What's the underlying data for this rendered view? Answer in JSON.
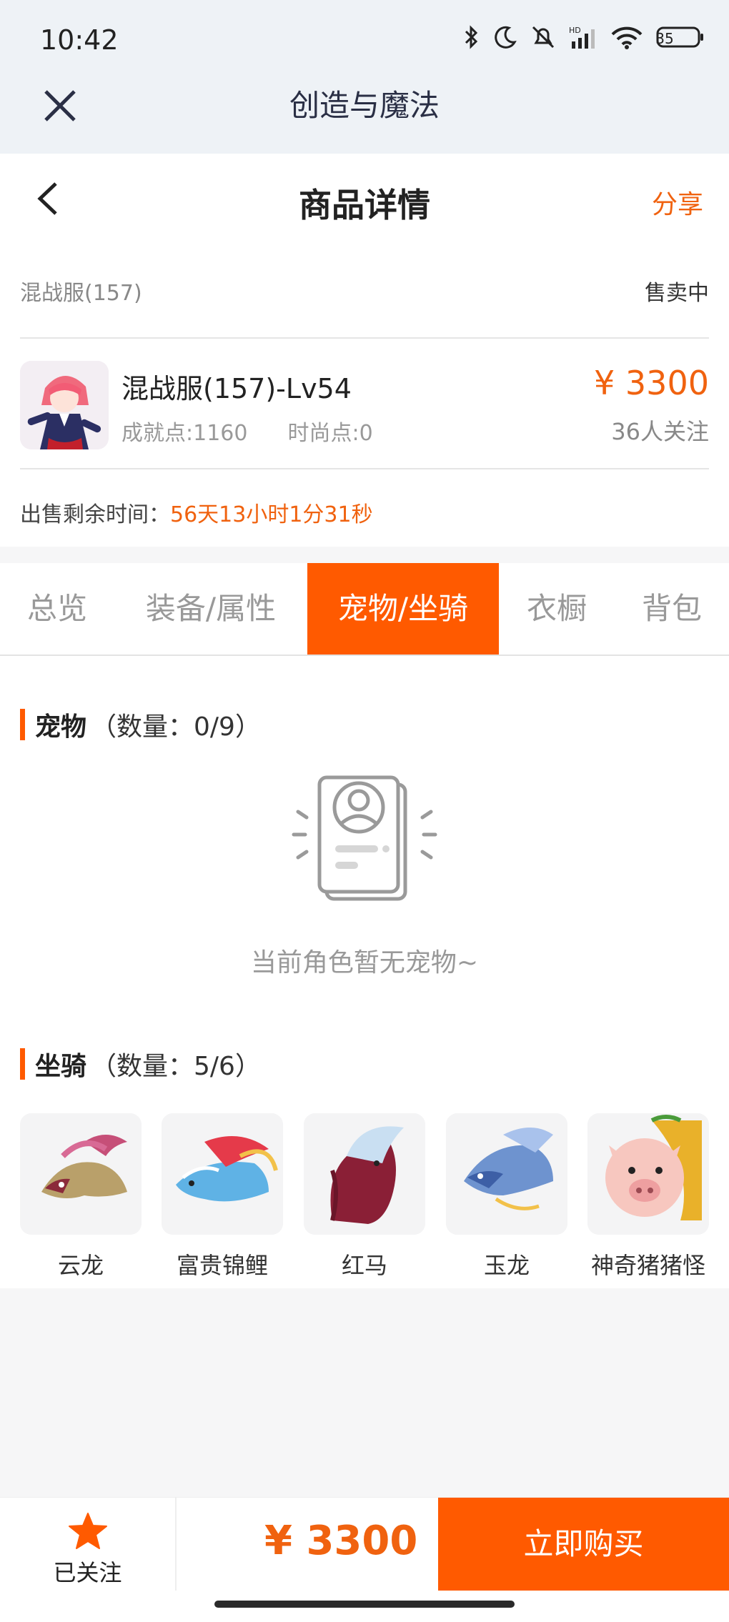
{
  "status_bar": {
    "time": "10:42",
    "battery": "35"
  },
  "app_header": {
    "title": "创造与魔法"
  },
  "nav": {
    "title": "商品详情",
    "share": "分享"
  },
  "listing": {
    "server": "混战服(157)",
    "status": "售卖中",
    "role_name": "混战服(157)-Lv54",
    "achievement": "成就点:1160",
    "fashion": "时尚点:0",
    "price": "¥ 3300",
    "followers": "36人关注",
    "time_label": "出售剩余时间：",
    "time_value": "56天13小时1分31秒"
  },
  "tabs": [
    {
      "label": "总览"
    },
    {
      "label": "装备/属性"
    },
    {
      "label": "宠物/坐骑",
      "active": true
    },
    {
      "label": "衣橱"
    },
    {
      "label": "背包"
    }
  ],
  "pets": {
    "title": "宠物",
    "count": "（数量：0/9）",
    "empty": "当前角色暂无宠物~"
  },
  "mounts": {
    "title": "坐骑",
    "count": "（数量：5/6）",
    "items": [
      {
        "name": "云龙"
      },
      {
        "name": "富贵锦鲤"
      },
      {
        "name": "红马"
      },
      {
        "name": "玉龙"
      },
      {
        "name": "神奇猪猪怪"
      }
    ]
  },
  "bottom": {
    "follow_label": "已关注",
    "price": "¥ 3300",
    "buy_label": "立即购买"
  },
  "colors": {
    "accent": "#ff5a00",
    "price": "#f0620f"
  }
}
